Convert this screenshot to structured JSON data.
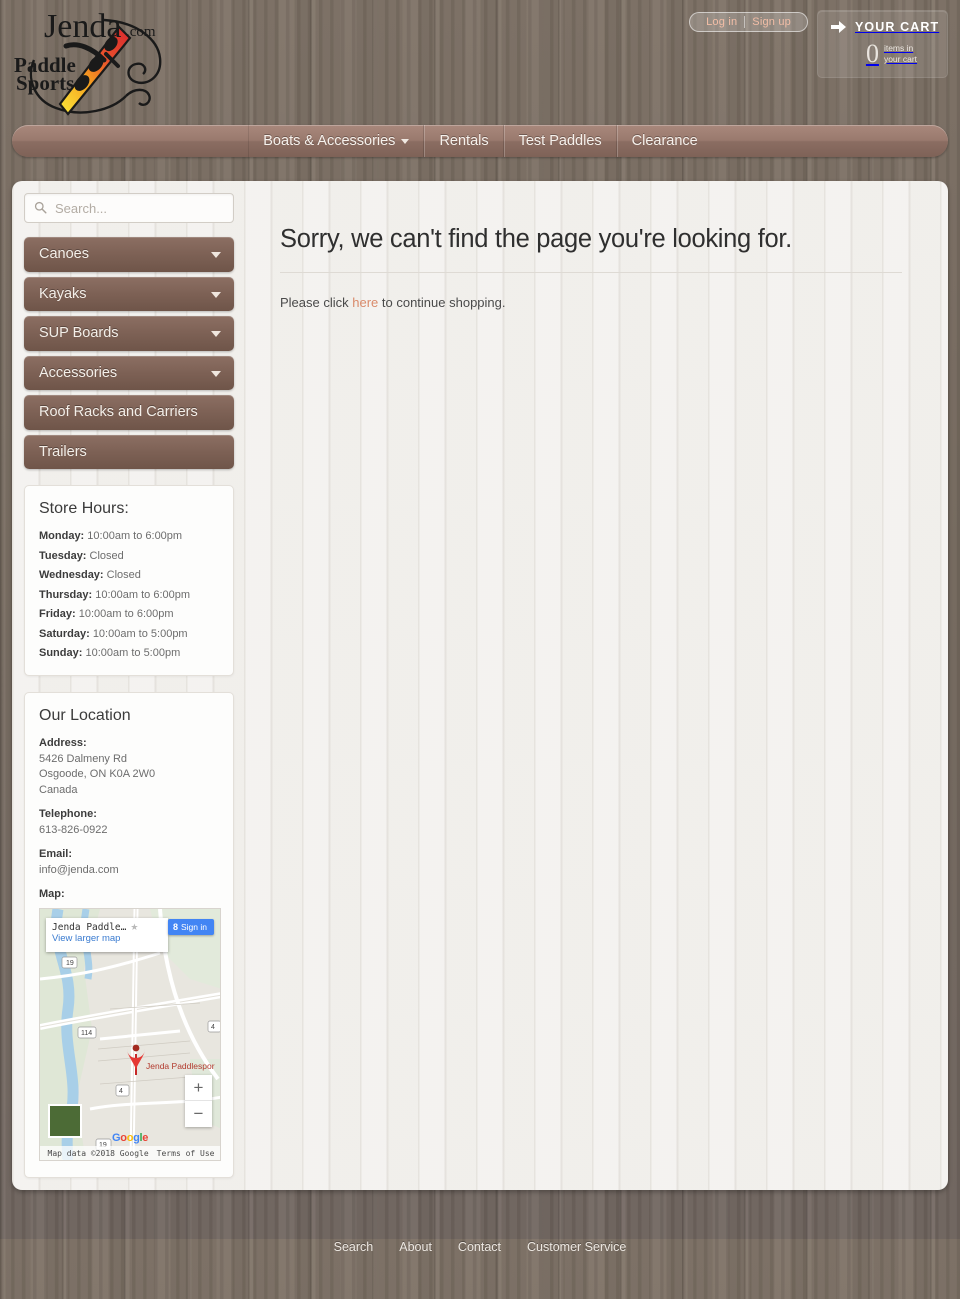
{
  "header": {
    "logo_alt": "Jenda.com Paddle Sports",
    "logo_brand": "Jenda",
    "logo_dotcom": ".com",
    "logo_line1": "Paddle",
    "logo_line2": "Sports",
    "login_label": "Log in",
    "signup_label": "Sign up",
    "cart_title": "YOUR CART",
    "cart_count": "0",
    "cart_sub_line1": "items in",
    "cart_sub_line2": "your cart"
  },
  "topnav": [
    {
      "label": "Boats & Accessories",
      "has_caret": true
    },
    {
      "label": "Rentals",
      "has_caret": false
    },
    {
      "label": "Test Paddles",
      "has_caret": false
    },
    {
      "label": "Clearance",
      "has_caret": false
    }
  ],
  "sidebar": {
    "search_placeholder": "Search...",
    "search_value": "",
    "menu": [
      {
        "label": "Canoes",
        "has_caret": true
      },
      {
        "label": "Kayaks",
        "has_caret": true
      },
      {
        "label": "SUP Boards",
        "has_caret": true
      },
      {
        "label": "Accessories",
        "has_caret": true
      },
      {
        "label": "Roof Racks and Carriers",
        "has_caret": false
      },
      {
        "label": "Trailers",
        "has_caret": false
      }
    ],
    "hours": {
      "title": "Store Hours:",
      "rows": [
        {
          "day": "Monday:",
          "time": "10:00am to 6:00pm"
        },
        {
          "day": "Tuesday:",
          "time": "Closed"
        },
        {
          "day": "Wednesday:",
          "time": "Closed"
        },
        {
          "day": "Thursday:",
          "time": "10:00am to 6:00pm"
        },
        {
          "day": "Friday:",
          "time": "10:00am to 6:00pm"
        },
        {
          "day": "Saturday:",
          "time": "10:00am to 5:00pm"
        },
        {
          "day": "Sunday:",
          "time": "10:00am to 5:00pm"
        }
      ]
    },
    "location": {
      "title": "Our Location",
      "address_label": "Address:",
      "address_line1": "5426 Dalmeny Rd",
      "address_line2": "Osgoode, ON K0A 2W0",
      "address_line3": "Canada",
      "telephone_label": "Telephone:",
      "telephone": "613-826-0922",
      "email_label": "Email:",
      "email": "info@jenda.com",
      "map_label": "Map:"
    },
    "map": {
      "place_title": "Jenda Paddle…",
      "view_larger": "View larger map",
      "signin_label": "Sign in",
      "signin_icon": "google-plus-icon",
      "marker_label": "Jenda Paddlespor",
      "zoom_in": "+",
      "zoom_out": "−",
      "brand": "Google",
      "attribution": "Map data ©2018 Google",
      "terms": "Terms of Use",
      "road_labels": [
        "19",
        "114",
        "4",
        "4",
        "19"
      ]
    }
  },
  "main": {
    "heading": "Sorry, we can't find the page you're looking for.",
    "body_before": "Please click ",
    "body_link": "here",
    "body_after": " to continue shopping."
  },
  "footer": {
    "links": [
      "Search",
      "About",
      "Contact",
      "Customer Service"
    ]
  },
  "colors": {
    "wood_bg": "#7a6e63",
    "panel_bg": "#e9e6e1",
    "button_brown": "#7d6155",
    "accent_link": "#d98a6a",
    "account_link": "#f2bda6",
    "map_blue": "#4285f4",
    "marker_red": "#e53935"
  }
}
